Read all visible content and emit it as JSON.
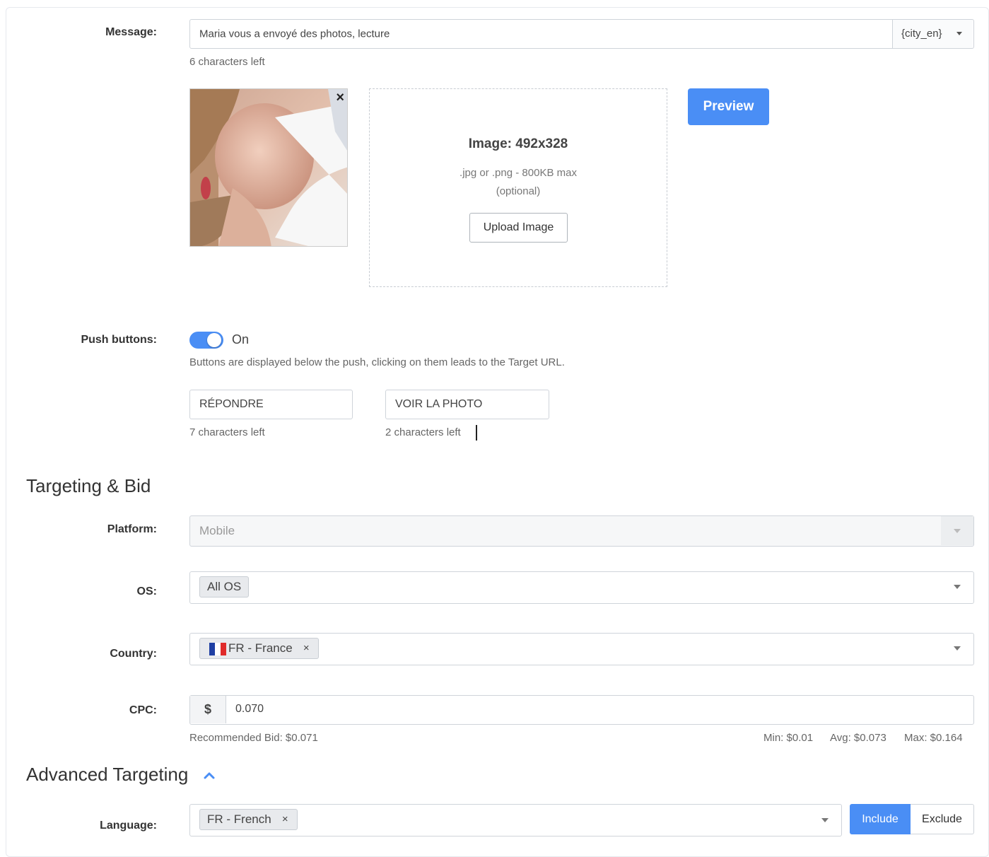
{
  "message": {
    "label": "Message:",
    "value": "Maria vous a envoyé des photos, lecture",
    "macro_dropdown": "{city_en}",
    "chars_left": "6 characters left"
  },
  "image_upload": {
    "dimension": "Image: 492x328",
    "formats": ".jpg or .png - 800KB max",
    "optional": "(optional)",
    "upload_button": "Upload Image",
    "remove_icon": "close-icon"
  },
  "preview_button": "Preview",
  "push_buttons": {
    "label": "Push buttons:",
    "toggle_state": "On",
    "toggle_on": true,
    "description": "Buttons are displayed below the push, clicking on them leads to the Target URL.",
    "button1": {
      "value": "RÉPONDRE",
      "chars_left": "7 characters left"
    },
    "button2": {
      "value": "VOIR LA PHOTO",
      "chars_left": "2 characters left"
    }
  },
  "targeting": {
    "title": "Targeting & Bid",
    "platform": {
      "label": "Platform:",
      "value": "Mobile"
    },
    "os": {
      "label": "OS:",
      "tag": "All OS"
    },
    "country": {
      "label": "Country:",
      "tag": "FR - France",
      "flag": "flag-france-icon",
      "remove": "×"
    },
    "cpc": {
      "label": "CPC:",
      "currency": "$",
      "value": "0.070",
      "recommended": "Recommended Bid: $0.071",
      "min": "Min: $0.01",
      "avg": "Avg: $0.073",
      "max": "Max: $0.164"
    }
  },
  "advanced": {
    "title": "Advanced Targeting",
    "expand_icon": "chevron-up-icon",
    "language": {
      "label": "Language:",
      "tag": "FR - French",
      "remove": "×",
      "include": "Include",
      "exclude": "Exclude"
    }
  },
  "colors": {
    "accent": "#4a8ef5",
    "border": "#cfd4da",
    "tag_bg": "#e8eaed",
    "text": "#333333"
  }
}
